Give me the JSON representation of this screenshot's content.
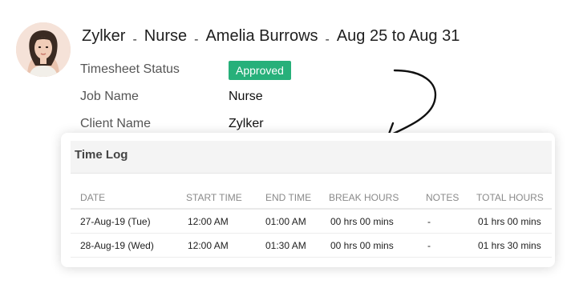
{
  "header": {
    "client": "Zylker",
    "job": "Nurse",
    "employee": "Amelia Burrows",
    "period": "Aug 25 to Aug 31",
    "separator": "-"
  },
  "details": {
    "status_label": "Timesheet Status",
    "status_value": "Approved",
    "job_label": "Job Name",
    "job_value": "Nurse",
    "client_label": "Client Name",
    "client_value": "Zylker"
  },
  "colors": {
    "approved_badge": "#27b07a"
  },
  "time_log": {
    "title": "Time Log",
    "columns": [
      "DATE",
      "START TIME",
      "END TIME",
      "BREAK HOURS",
      "NOTES",
      "TOTAL HOURS"
    ],
    "rows": [
      [
        "27-Aug-19 (Tue)",
        "12:00 AM",
        "01:00 AM",
        "00 hrs 00 mins",
        "-",
        "01 hrs 00 mins"
      ],
      [
        "28-Aug-19 (Wed)",
        "12:00 AM",
        "01:30 AM",
        "00 hrs 00 mins",
        "-",
        "01 hrs 30 mins"
      ]
    ]
  }
}
